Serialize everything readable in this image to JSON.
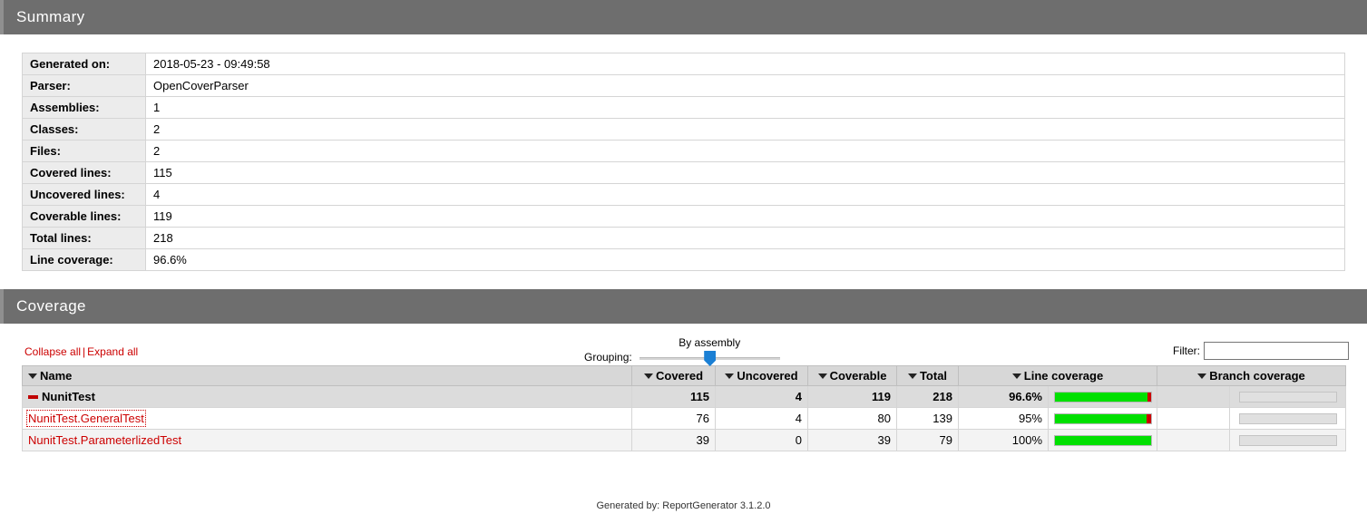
{
  "summary": {
    "title": "Summary",
    "rows": [
      {
        "key": "Generated on:",
        "value": "2018-05-23 - 09:49:58"
      },
      {
        "key": "Parser:",
        "value": "OpenCoverParser"
      },
      {
        "key": "Assemblies:",
        "value": "1"
      },
      {
        "key": "Classes:",
        "value": "2"
      },
      {
        "key": "Files:",
        "value": "2"
      },
      {
        "key": "Covered lines:",
        "value": "115"
      },
      {
        "key": "Uncovered lines:",
        "value": "4"
      },
      {
        "key": "Coverable lines:",
        "value": "119"
      },
      {
        "key": "Total lines:",
        "value": "218"
      },
      {
        "key": "Line coverage:",
        "value": "96.6%"
      }
    ]
  },
  "coverage": {
    "title": "Coverage",
    "toolbar": {
      "collapse_all": "Collapse all",
      "separator": "|",
      "expand_all": "Expand all",
      "grouping_label": "Grouping:",
      "grouping_value": "By assembly",
      "grouping_position_pct": 50,
      "filter_label": "Filter:",
      "filter_value": "",
      "filter_placeholder": ""
    },
    "columns": [
      {
        "label": "Name",
        "sortable": true
      },
      {
        "label": "Covered",
        "sortable": true
      },
      {
        "label": "Uncovered",
        "sortable": true
      },
      {
        "label": "Coverable",
        "sortable": true
      },
      {
        "label": "Total",
        "sortable": true
      },
      {
        "label": "Line coverage",
        "sortable": true
      },
      {
        "label": "Branch coverage",
        "sortable": true
      }
    ],
    "rows": [
      {
        "name": "NunitTest",
        "type": "assembly",
        "covered": "115",
        "uncovered": "4",
        "coverable": "119",
        "total": "218",
        "line_coverage": "96.6%",
        "line_coverage_pct": 96.6,
        "branch_coverage": "",
        "branch_coverage_pct": null
      },
      {
        "name": "NunitTest.GeneralTest",
        "type": "class",
        "covered": "76",
        "uncovered": "4",
        "coverable": "80",
        "total": "139",
        "line_coverage": "95%",
        "line_coverage_pct": 95,
        "branch_coverage": "",
        "branch_coverage_pct": null
      },
      {
        "name": "NunitTest.ParameterlizedTest",
        "type": "class",
        "covered": "39",
        "uncovered": "0",
        "coverable": "39",
        "total": "79",
        "line_coverage": "100%",
        "line_coverage_pct": 100,
        "branch_coverage": "",
        "branch_coverage_pct": null
      }
    ]
  },
  "footer": {
    "text": "Generated by: ReportGenerator 3.1.2.0"
  },
  "colors": {
    "header_bar": "#6e6e6e",
    "link_red": "#cc0000",
    "bar_green": "#00e000",
    "bar_red": "#cc0000",
    "slider_blue": "#1a7fd4"
  }
}
